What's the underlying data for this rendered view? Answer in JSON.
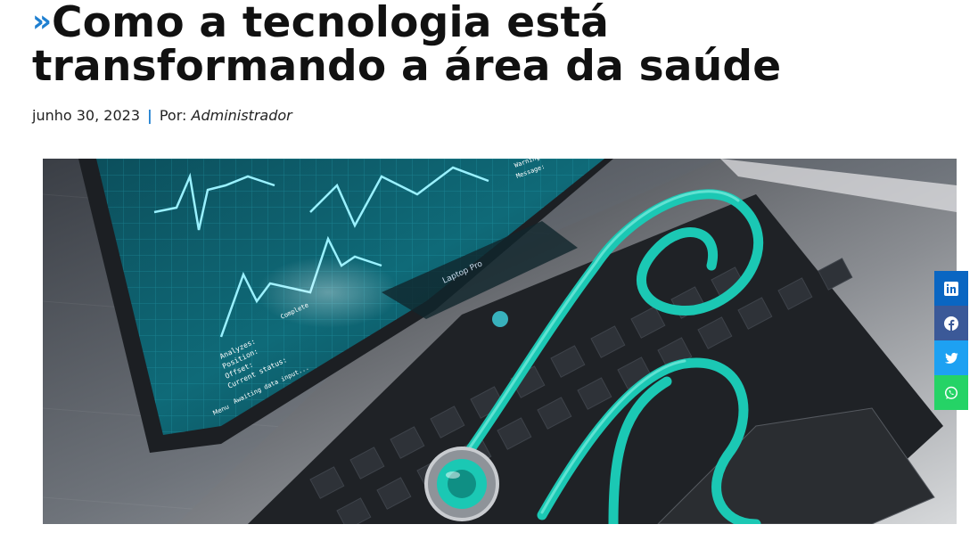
{
  "article": {
    "chevron": "»",
    "title": "Como a tecnologia está transformando a área da saúde",
    "date": "junho 30, 2023",
    "separator": "|",
    "author_prefix": "Por:",
    "author": "Administrador"
  },
  "hero_image": {
    "icon": "laptop-with-stethoscope-image",
    "screen_labels": {
      "model": "Laptop Pro",
      "analyzes": "Analyzes:",
      "position": "Position:",
      "offset": "Offset:",
      "current_status": "Current status:",
      "complete": "Complete",
      "awaiting": "Awaiting data input...",
      "menu": "Menu",
      "warnings": "Warnings",
      "message": "Message:"
    }
  },
  "share_buttons": [
    {
      "name": "linkedin",
      "icon": "linkedin-icon",
      "color": "#0a66c2"
    },
    {
      "name": "facebook",
      "icon": "facebook-icon",
      "color": "#3b5998"
    },
    {
      "name": "twitter",
      "icon": "twitter-icon",
      "color": "#1da1f2"
    },
    {
      "name": "whatsapp",
      "icon": "whatsapp-icon",
      "color": "#25d366"
    }
  ],
  "colors": {
    "accent": "#1e7fd0",
    "title": "#111111"
  }
}
